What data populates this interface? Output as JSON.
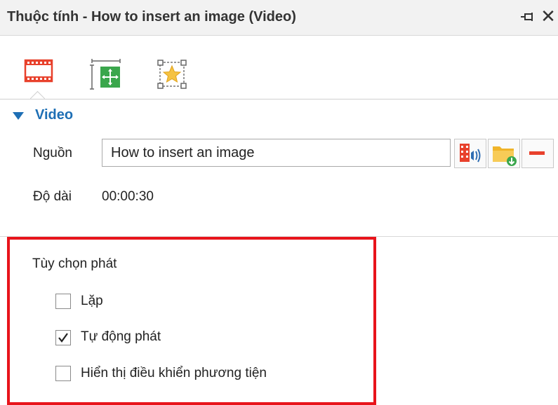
{
  "panel": {
    "title": "Thuộc tính - How to insert an image (Video)",
    "pin_icon": "pin-icon",
    "close_symbol": "✕"
  },
  "tabs": [
    {
      "icon": "film-strip-icon",
      "selected": true
    },
    {
      "icon": "size-position-icon",
      "selected": false
    },
    {
      "icon": "effects-star-icon",
      "selected": false
    }
  ],
  "section": {
    "title": "Video",
    "expanded": true
  },
  "source": {
    "label": "Nguồn",
    "value": "How to insert an image",
    "buttons": [
      {
        "icon": "video-audio-icon"
      },
      {
        "icon": "open-folder-icon"
      },
      {
        "icon": "remove-icon"
      }
    ]
  },
  "duration": {
    "label": "Độ dài",
    "value": "00:00:30"
  },
  "playback": {
    "title": "Tùy chọn phát",
    "options": [
      {
        "label": "Lặp",
        "checked": false
      },
      {
        "label": "Tự động phát",
        "checked": true
      },
      {
        "label": "Hiển thị điều khiển phương tiện",
        "checked": false
      }
    ]
  },
  "colors": {
    "accent": "#1e6fb5",
    "highlight_border": "#e8141b",
    "tab_icon": "#e8412c",
    "remove": "#e8412c",
    "green": "#3aa64c",
    "folder": "#f0b429"
  }
}
